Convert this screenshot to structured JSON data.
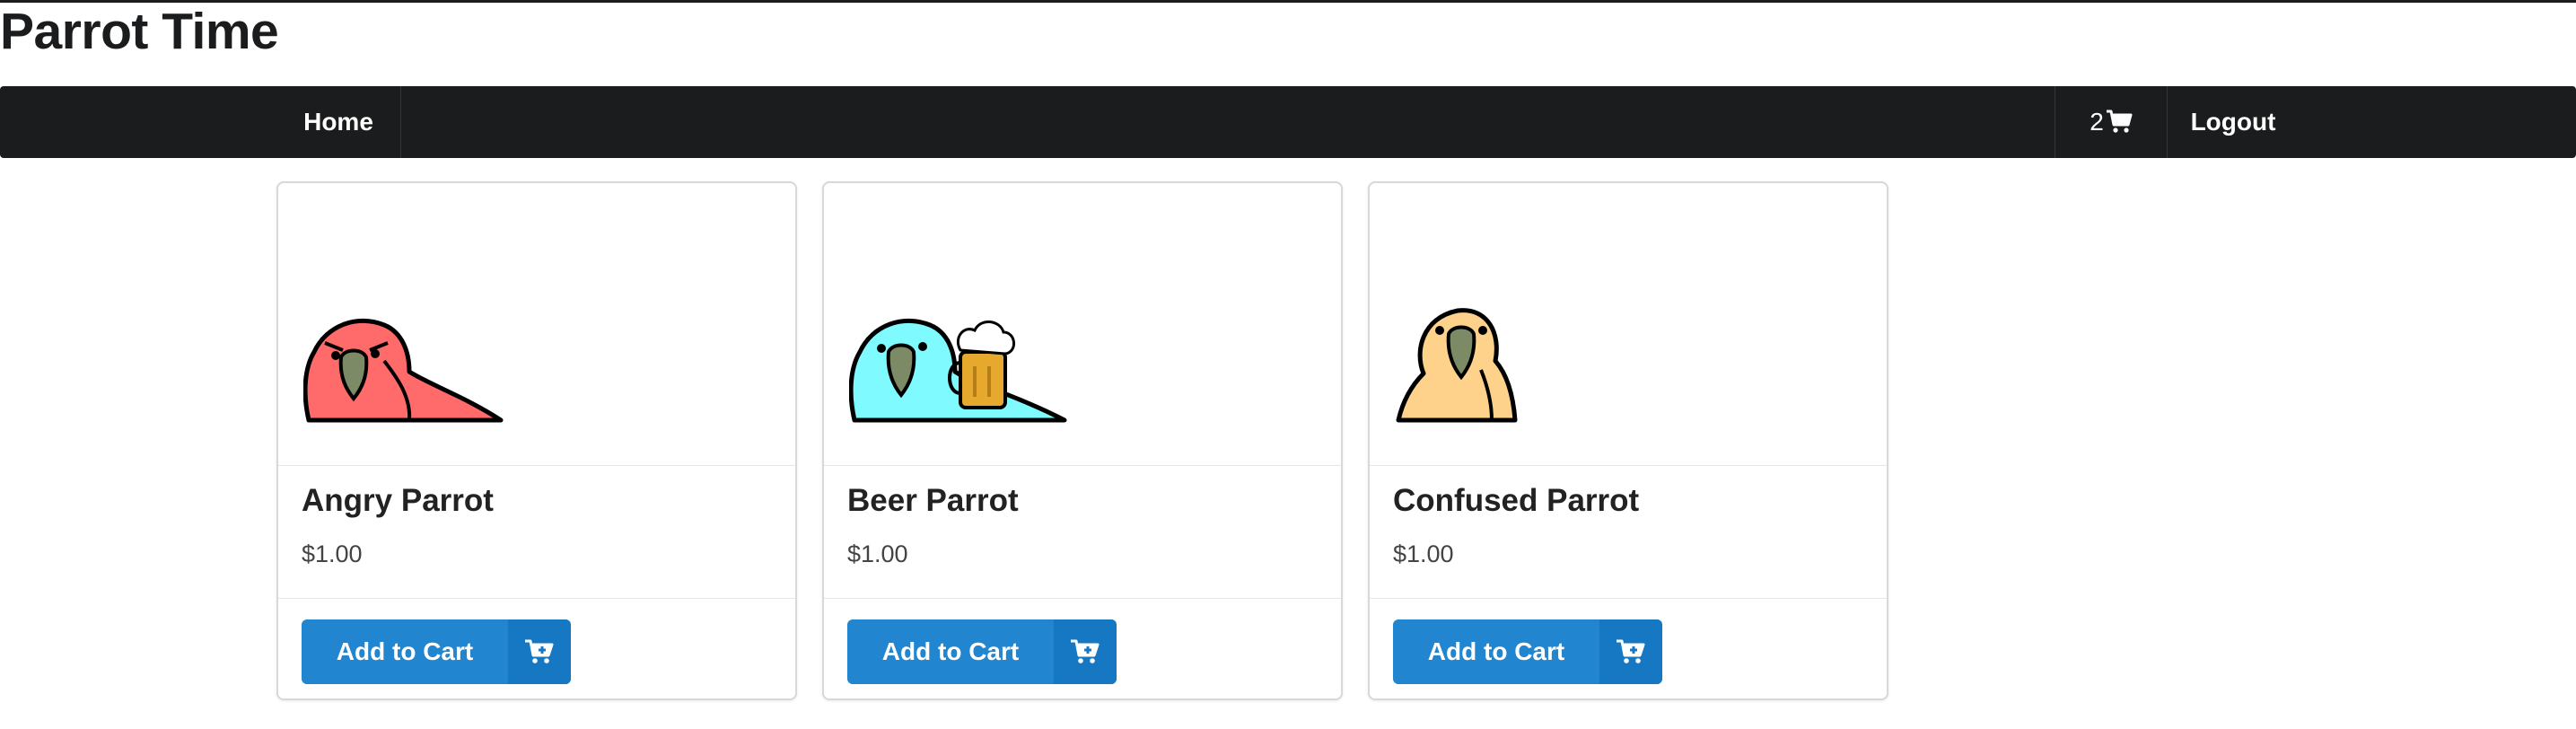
{
  "site": {
    "title": "Parrot Time"
  },
  "menu": {
    "home_label": "Home",
    "cart_count": "2",
    "cart_icon": "shopping-cart-icon",
    "logout_label": "Logout"
  },
  "products": [
    {
      "name": "Angry Parrot",
      "price": "$1.00",
      "button_label": "Add to Cart",
      "image": "angry-parrot",
      "body_color": "#ff6b6b"
    },
    {
      "name": "Beer Parrot",
      "price": "$1.00",
      "button_label": "Add to Cart",
      "image": "beer-parrot",
      "body_color": "#7ffaff"
    },
    {
      "name": "Confused Parrot",
      "price": "$1.00",
      "button_label": "Add to Cart",
      "image": "confused-parrot",
      "body_color": "#ffd28c"
    }
  ],
  "colors": {
    "menubar": "#1b1c1d",
    "primary_button": "#2185d0",
    "primary_button_dark": "#1678c2"
  }
}
